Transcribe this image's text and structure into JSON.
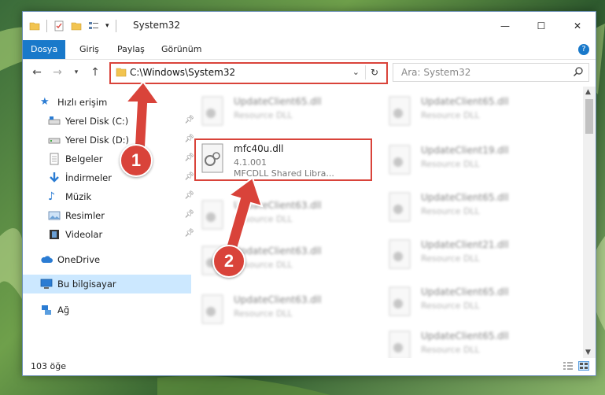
{
  "window": {
    "title": "System32",
    "controls": {
      "minimize": "—",
      "maximize": "☐",
      "close": "✕"
    }
  },
  "ribbon": {
    "tabs": [
      {
        "label": "Dosya",
        "active": true
      },
      {
        "label": "Giriş",
        "active": false
      },
      {
        "label": "Paylaş",
        "active": false
      },
      {
        "label": "Görünüm",
        "active": false
      }
    ],
    "help": "?"
  },
  "address": {
    "path": "C:\\Windows\\System32"
  },
  "search": {
    "placeholder": "Ara: System32"
  },
  "nav": {
    "items": [
      {
        "label": "Hızlı erişim",
        "icon": "star-icon"
      },
      {
        "label": "Yerel Disk (C:)",
        "icon": "drive-icon",
        "pinned": true
      },
      {
        "label": "Yerel Disk (D:)",
        "icon": "drive-icon",
        "pinned": true
      },
      {
        "label": "Belgeler",
        "icon": "documents-icon",
        "pinned": true
      },
      {
        "label": "İndirmeler",
        "icon": "download-icon",
        "pinned": true
      },
      {
        "label": "Müzik",
        "icon": "music-icon",
        "pinned": true
      },
      {
        "label": "Resimler",
        "icon": "pictures-icon",
        "pinned": true
      },
      {
        "label": "Videolar",
        "icon": "video-icon",
        "pinned": true
      },
      {
        "label": "OneDrive",
        "icon": "cloud-icon"
      },
      {
        "label": "Bu bilgisayar",
        "icon": "computer-icon",
        "selected": true
      },
      {
        "label": "Ağ",
        "icon": "network-icon"
      }
    ]
  },
  "files": {
    "highlighted": {
      "name": "mfc40u.dll",
      "version": "4.1.001",
      "description": "MFCDLL Shared Libra..."
    },
    "left_column": [
      {
        "name": "UpdateClient65.dll",
        "type": "Resource DLL"
      },
      {
        "name": "UpdateClient63.dll",
        "type": "Resource DLL"
      },
      {
        "name": "UpdateClient63.dll",
        "type": "Resource DLL"
      },
      {
        "name": "UpdateClient63.dll",
        "type": "Resource DLL"
      }
    ],
    "right_column": [
      {
        "name": "UpdateClient65.dll",
        "type": "Resource DLL"
      },
      {
        "name": "UpdateClient19.dll",
        "type": "Resource DLL"
      },
      {
        "name": "UpdateClient65.dll",
        "type": "Resource DLL"
      },
      {
        "name": "UpdateClient21.dll",
        "type": "Resource DLL"
      },
      {
        "name": "UpdateClient65.dll",
        "type": "Resource DLL"
      },
      {
        "name": "UpdateClient65.dll",
        "type": "Resource DLL"
      }
    ]
  },
  "status": {
    "count": "103 öğe"
  },
  "annotations": {
    "marker1": "1",
    "marker2": "2",
    "color": "#d9433a"
  }
}
